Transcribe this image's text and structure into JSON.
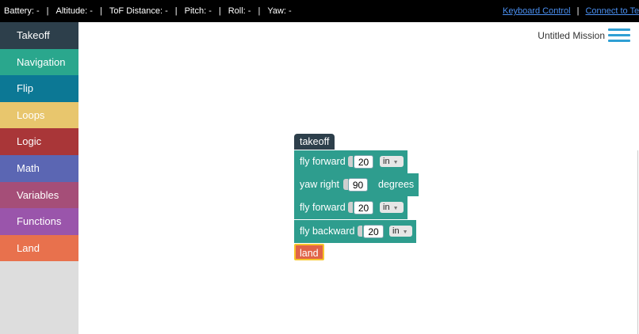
{
  "topbar": {
    "stats": [
      "Battery: -",
      "Altitude: -",
      "ToF Distance: -",
      "Pitch: -",
      "Roll: -",
      "Yaw: -"
    ],
    "separator": "|",
    "keyboard_control": "Keyboard Control",
    "connect_to": "Connect to Tello"
  },
  "sidebar": {
    "categories": [
      {
        "label": "Takeoff",
        "color": "#2d3f4b"
      },
      {
        "label": "Navigation",
        "color": "#2aa78d"
      },
      {
        "label": "Flip",
        "color": "#0c7895"
      },
      {
        "label": "Loops",
        "color": "#e8c66d"
      },
      {
        "label": "Logic",
        "color": "#a93638"
      },
      {
        "label": "Math",
        "color": "#5b66b3"
      },
      {
        "label": "Variables",
        "color": "#a54e78"
      },
      {
        "label": "Functions",
        "color": "#9a55ab"
      },
      {
        "label": "Land",
        "color": "#e8714d"
      }
    ]
  },
  "header": {
    "mission_title": "Untitled Mission"
  },
  "blocks": {
    "takeoff": "takeoff",
    "fly_forward_1": {
      "label": "fly forward",
      "value": "20",
      "unit": "in"
    },
    "yaw_right": {
      "label": "yaw right",
      "value": "90",
      "suffix": "degrees"
    },
    "fly_forward_2": {
      "label": "fly forward",
      "value": "20",
      "unit": "in"
    },
    "fly_backward": {
      "label": "fly backward",
      "value": "20",
      "unit": "in"
    },
    "land": "land"
  }
}
